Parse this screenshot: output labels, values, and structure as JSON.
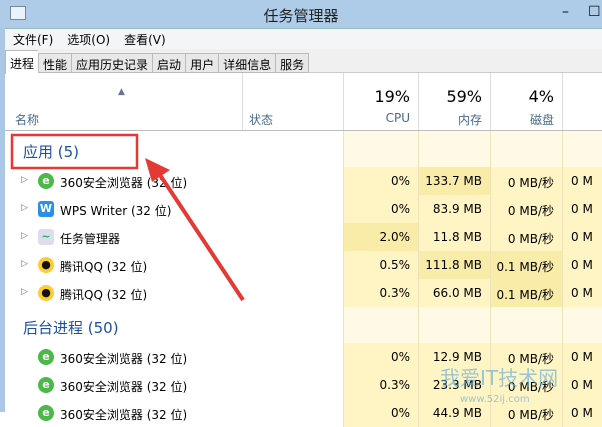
{
  "window": {
    "title": "任务管理器",
    "minimize": "–",
    "maximize": "☐"
  },
  "menu": [
    "文件(F)",
    "选项(O)",
    "查看(V)"
  ],
  "tabs": [
    "进程",
    "性能",
    "应用历史记录",
    "启动",
    "用户",
    "详细信息",
    "服务"
  ],
  "header": {
    "sort_arrow": "▲",
    "name": "名称",
    "status": "状态",
    "cpu_pct": "19%",
    "cpu": "CPU",
    "mem_pct": "59%",
    "mem": "内存",
    "disk_pct": "4%",
    "disk": "磁盘"
  },
  "groups": [
    {
      "title": "应用 (5)",
      "rows": [
        {
          "icon": "ie-360-icon",
          "name": "360安全浏览器 (32 位)",
          "cpu": "0%",
          "mem": "133.7 MB",
          "disk": "0 MB/秒",
          "net": "0 M"
        },
        {
          "icon": "wps-icon",
          "name": "WPS Writer (32 位)",
          "cpu": "0%",
          "mem": "83.9 MB",
          "disk": "0 MB/秒",
          "net": "0 M"
        },
        {
          "icon": "task-manager-icon",
          "name": "任务管理器",
          "cpu": "2.0%",
          "mem": "11.8 MB",
          "disk": "0 MB/秒",
          "net": "0 M"
        },
        {
          "icon": "qq-icon",
          "name": "腾讯QQ (32 位)",
          "cpu": "0.5%",
          "mem": "111.8 MB",
          "disk": "0.1 MB/秒",
          "net": "0 M"
        },
        {
          "icon": "qq-icon",
          "name": "腾讯QQ (32 位)",
          "cpu": "0.3%",
          "mem": "66.0 MB",
          "disk": "0.1 MB/秒",
          "net": "0 M"
        }
      ]
    },
    {
      "title": "后台进程 (50)",
      "rows": [
        {
          "icon": "ie-360-icon",
          "name": "360安全浏览器 (32 位)",
          "cpu": "0%",
          "mem": "12.9 MB",
          "disk": "0 MB/秒",
          "net": "0 M"
        },
        {
          "icon": "ie-360-icon",
          "name": "360安全浏览器 (32 位)",
          "cpu": "0.3%",
          "mem": "23.3 MB",
          "disk": "0 MB/秒",
          "net": "0 M"
        },
        {
          "icon": "ie-360-icon",
          "name": "360安全浏览器 (32 位)",
          "cpu": "0%",
          "mem": "44.9 MB",
          "disk": "0 MB/秒",
          "net": "0 M"
        }
      ]
    }
  ],
  "colors": {
    "heat_light": "#fff4c4",
    "heat_mid": "#f9eba8",
    "group_blue": "#1e50a2",
    "annotation": "#e53935"
  },
  "watermark": {
    "text": "我爱IT技术网",
    "url": "www.52ij.com"
  }
}
